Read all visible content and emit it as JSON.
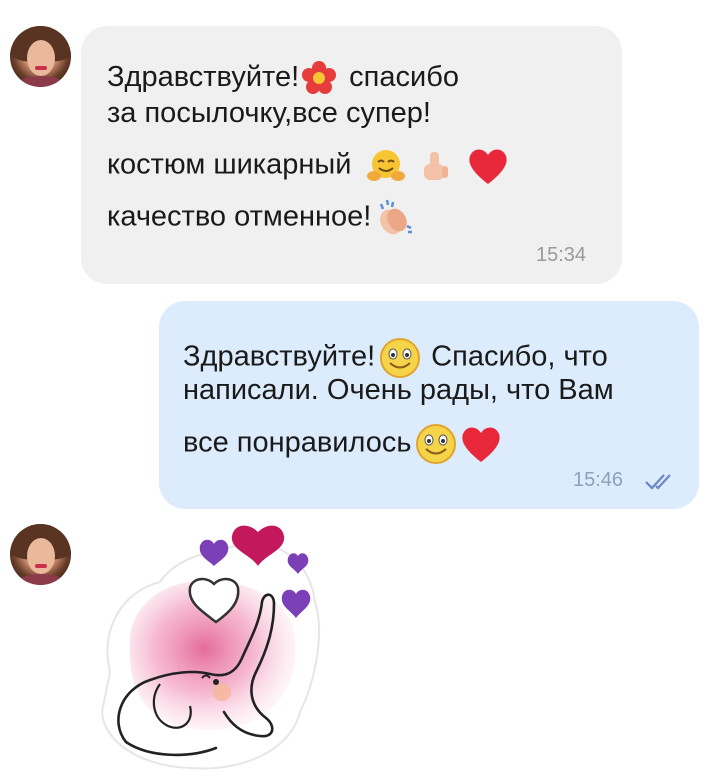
{
  "messages": [
    {
      "sender": "contact",
      "lines": [
        "Здравствуйте!",
        "спасибо",
        "за посылочку,все супер!",
        "костюм шикарный",
        "качество отменное!"
      ],
      "time": "15:34"
    },
    {
      "sender": "me",
      "lines": [
        "Здравствуйте!",
        "Спасибо, что",
        "написали. Очень рады, что Вам",
        "все понравилось"
      ],
      "time": "15:46"
    }
  ],
  "icons": {
    "flower": "flower-icon",
    "hug": "hugging-face-icon",
    "thumbs_up": "thumbs-up-icon",
    "heart": "red-heart-icon",
    "clap": "clapping-hands-icon",
    "smile": "smiling-face-icon",
    "read_receipt": "double-check-icon"
  },
  "colors": {
    "incoming_bubble": "#f0f0f0",
    "outgoing_bubble": "#dcecfc",
    "heart": "#e8283a",
    "check": "#6b86c9"
  }
}
